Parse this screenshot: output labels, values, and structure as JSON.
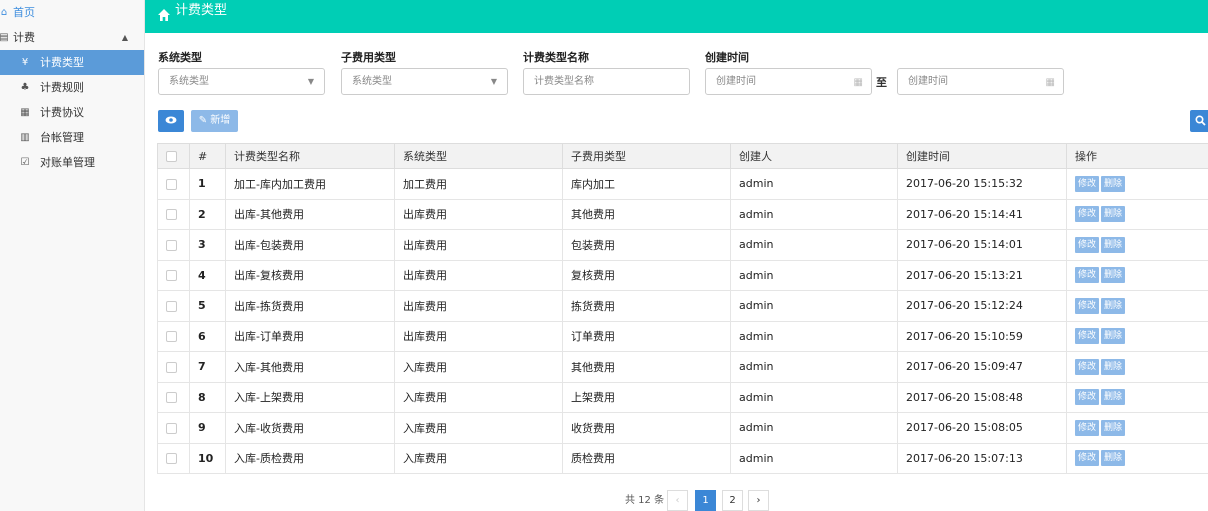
{
  "sidebar": {
    "home": "首页",
    "group": "计费",
    "items": [
      {
        "label": "计费类型",
        "icon": "yen-icon"
      },
      {
        "label": "计费规则",
        "icon": "sitemap-icon"
      },
      {
        "label": "计费协议",
        "icon": "calendar-icon"
      },
      {
        "label": "台帐管理",
        "icon": "document-icon"
      },
      {
        "label": "对账单管理",
        "icon": "checklist-icon"
      }
    ]
  },
  "header": {
    "title": "计费类型"
  },
  "filters": {
    "system_type": {
      "label": "系统类型",
      "value": "系统类型"
    },
    "sub_fee_type": {
      "label": "子费用类型",
      "value": "系统类型"
    },
    "fee_type_name": {
      "label": "计费类型名称",
      "placeholder": "计费类型名称"
    },
    "create_time": {
      "label": "创建时间",
      "from_placeholder": "创建时间",
      "to_placeholder": "创建时间",
      "to_label": "至"
    }
  },
  "toolbar": {
    "new_label": "新增"
  },
  "table": {
    "columns": [
      "#",
      "计费类型名称",
      "系统类型",
      "子费用类型",
      "创建人",
      "创建时间",
      "操作"
    ],
    "rows": [
      {
        "idx": "1",
        "name": "加工-库内加工费用",
        "sys": "加工费用",
        "sub": "库内加工",
        "creator": "admin",
        "time": "2017-06-20 15:15:32"
      },
      {
        "idx": "2",
        "name": "出库-其他费用",
        "sys": "出库费用",
        "sub": "其他费用",
        "creator": "admin",
        "time": "2017-06-20 15:14:41"
      },
      {
        "idx": "3",
        "name": "出库-包装费用",
        "sys": "出库费用",
        "sub": "包装费用",
        "creator": "admin",
        "time": "2017-06-20 15:14:01"
      },
      {
        "idx": "4",
        "name": "出库-复核费用",
        "sys": "出库费用",
        "sub": "复核费用",
        "creator": "admin",
        "time": "2017-06-20 15:13:21"
      },
      {
        "idx": "5",
        "name": "出库-拣货费用",
        "sys": "出库费用",
        "sub": "拣货费用",
        "creator": "admin",
        "time": "2017-06-20 15:12:24"
      },
      {
        "idx": "6",
        "name": "出库-订单费用",
        "sys": "出库费用",
        "sub": "订单费用",
        "creator": "admin",
        "time": "2017-06-20 15:10:59"
      },
      {
        "idx": "7",
        "name": "入库-其他费用",
        "sys": "入库费用",
        "sub": "其他费用",
        "creator": "admin",
        "time": "2017-06-20 15:09:47"
      },
      {
        "idx": "8",
        "name": "入库-上架费用",
        "sys": "入库费用",
        "sub": "上架费用",
        "creator": "admin",
        "time": "2017-06-20 15:08:48"
      },
      {
        "idx": "9",
        "name": "入库-收货费用",
        "sys": "入库费用",
        "sub": "收货费用",
        "creator": "admin",
        "time": "2017-06-20 15:08:05"
      },
      {
        "idx": "10",
        "name": "入库-质检费用",
        "sys": "入库费用",
        "sub": "质检费用",
        "creator": "admin",
        "time": "2017-06-20 15:07:13"
      }
    ],
    "edit_label": "修改",
    "delete_label": "删除"
  },
  "pagination": {
    "total": "共 12 条",
    "prev": "‹",
    "pages": [
      "1",
      "2"
    ],
    "next": "›",
    "current": "1"
  },
  "colors": {
    "header": "#00ceb5",
    "primary": "#3b87d6",
    "sidebar_active": "#5b9bd9"
  }
}
